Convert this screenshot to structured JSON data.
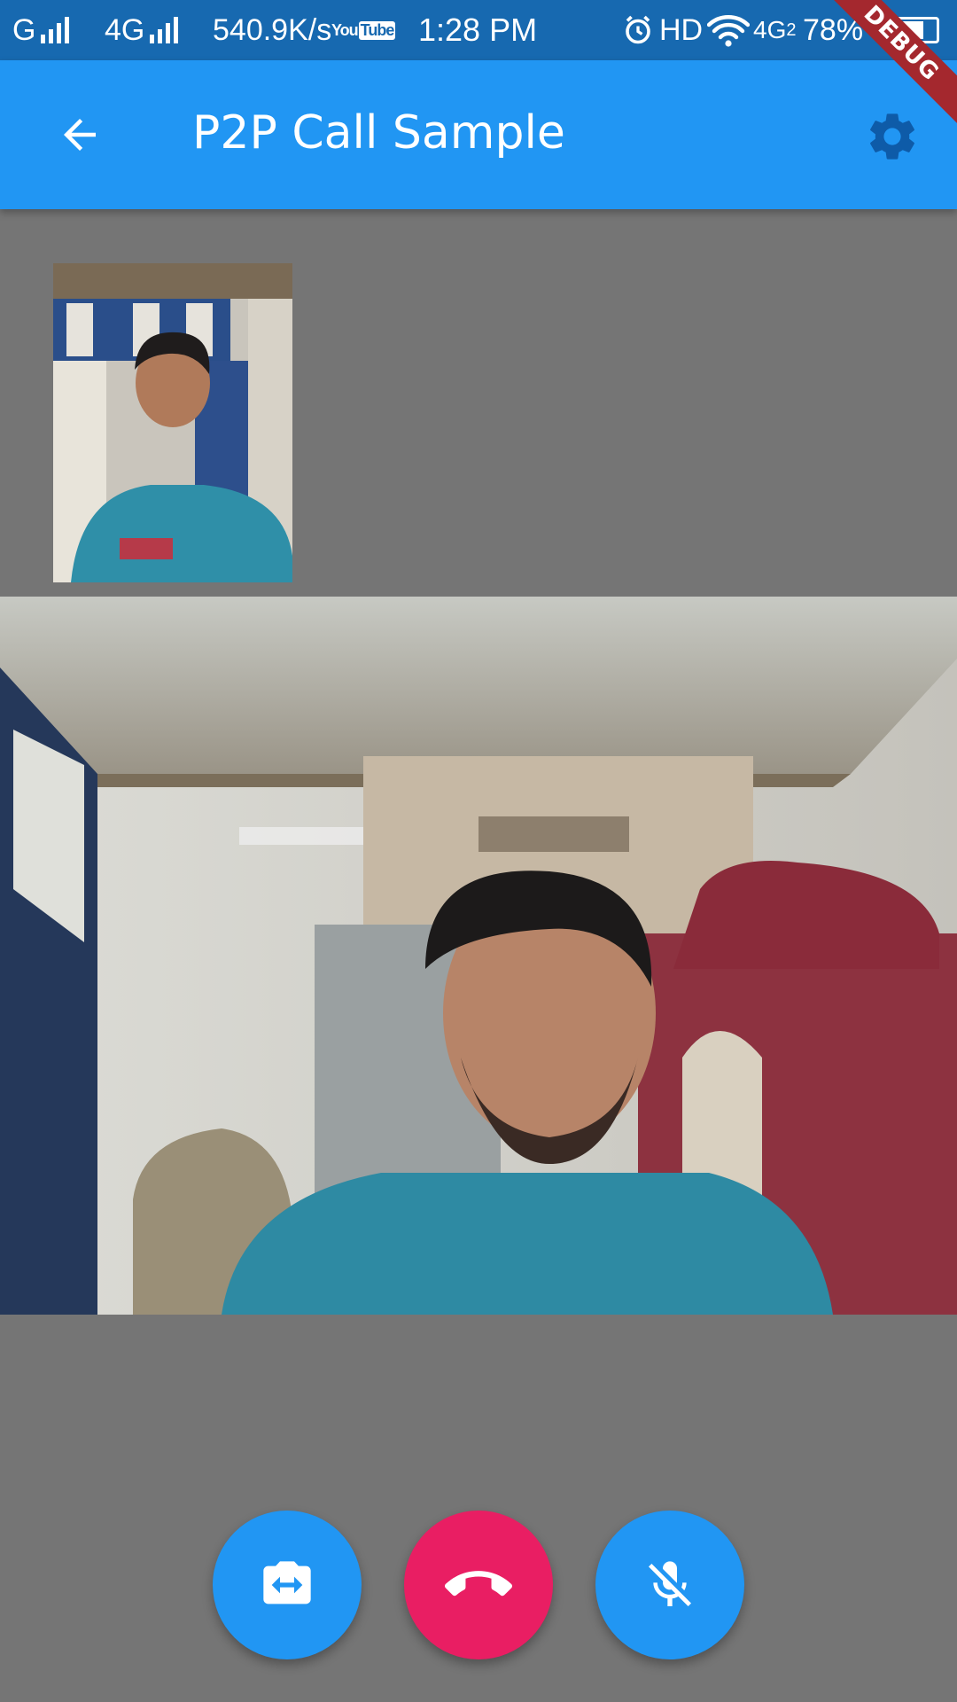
{
  "status_bar": {
    "carrier1": "G",
    "network2": "4G",
    "speed": "540.9K/s",
    "youtube_a": "You",
    "youtube_b": "Tube",
    "time": "1:28 PM",
    "hd": "HD",
    "network3": "4G",
    "network3_sub": "2",
    "battery": "78%",
    "battery_level": 0.78
  },
  "app_bar": {
    "title": "P2P Call Sample",
    "back_icon": "arrow-back-icon",
    "settings_icon": "gear-icon"
  },
  "debug_banner": "DEBUG",
  "controls": [
    {
      "icon": "switch-camera-icon",
      "color": "#2196f3"
    },
    {
      "icon": "call-end-icon",
      "color": "#e91e63"
    },
    {
      "icon": "mic-off-icon",
      "color": "#2196f3"
    }
  ],
  "colors": {
    "primary": "#2196f3",
    "status_bar": "#1769b0",
    "background": "#757575",
    "hangup": "#e91e63",
    "debug": "#a4282e"
  }
}
